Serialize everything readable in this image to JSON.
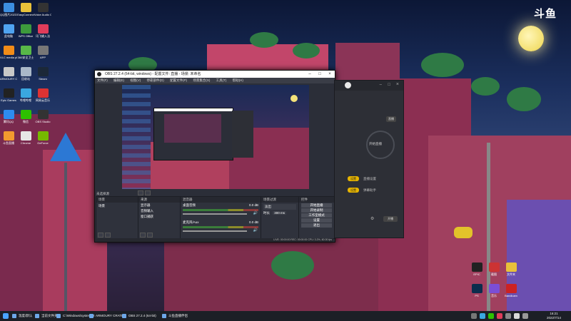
{
  "watermark": "斗鱼",
  "desktop_left": [
    {
      "label": "QQ图片20231231",
      "color": "#3c8ee0"
    },
    {
      "label": "EasyConnect",
      "color": "#e8c13a"
    },
    {
      "label": "Voice Audio Center",
      "color": "#333"
    },
    {
      "label": "此电脑",
      "color": "#4fa3f0"
    },
    {
      "label": "WPS Office",
      "color": "#3d9a3c"
    },
    {
      "label": "讯飞输入法",
      "color": "#e03c5a"
    },
    {
      "label": "VLC media player",
      "color": "#f28c18"
    },
    {
      "label": "360安全卫士",
      "color": "#58b848"
    },
    {
      "label": "APP",
      "color": "#777"
    },
    {
      "label": "ARMOURY CRATE",
      "color": "#c8c8c8"
    },
    {
      "label": "回收站",
      "color": "#aab8c8"
    },
    {
      "label": "Steam",
      "color": "#1b2838"
    },
    {
      "label": "Epic Games",
      "color": "#222"
    },
    {
      "label": "哔哩哔哩",
      "color": "#3aa7e0"
    },
    {
      "label": "网易云音乐",
      "color": "#d33"
    },
    {
      "label": "腾讯QQ",
      "color": "#2d8cf0"
    },
    {
      "label": "微信",
      "color": "#2dc100"
    },
    {
      "label": "OBS Studio",
      "color": "#333"
    },
    {
      "label": "斗鱼直播",
      "color": "#f29a2e"
    },
    {
      "label": "Chrome",
      "color": "#e6e6e6"
    },
    {
      "label": "GeForce",
      "color": "#76b900"
    }
  ],
  "desktop_right": [
    {
      "label": "EPIC",
      "color": "#222"
    },
    {
      "label": "截图",
      "color": "#c33"
    },
    {
      "label": "文件夹",
      "color": "#e8c13a"
    },
    {
      "label": "PS",
      "color": "#0b2d4d"
    },
    {
      "label": "音乐",
      "color": "#7b4ed6"
    },
    {
      "label": "Bandicam",
      "color": "#c22"
    }
  ],
  "obs": {
    "title": "OBS 27.2.4 (64-bit, windows) - 配置文件: 直播 - 场景: 未命名",
    "menu": [
      "文件(F)",
      "编辑(E)",
      "视图(V)",
      "停靠部件(D)",
      "配置文件(P)",
      "场景集合(S)",
      "工具(T)",
      "帮助(H)"
    ],
    "docks": {
      "scenes": {
        "title": "场景",
        "items": [
          "场景"
        ]
      },
      "sources": {
        "title": "来源",
        "items": [
          "显示器",
          "音频输入",
          "窗口捕获"
        ]
      },
      "mixer": {
        "title": "混音器",
        "tracks": [
          {
            "name": "桌面音频",
            "level": "0.0 dB"
          },
          {
            "name": "麦克风/Aux",
            "level": "0.0 dB"
          }
        ]
      },
      "transition": {
        "title": "场景过渡",
        "type": "淡出",
        "duration_label": "时长",
        "duration": "300 ms"
      },
      "controls": {
        "title": "控件",
        "buttons": [
          "开始直播",
          "开始录制",
          "工作室模式",
          "设置",
          "退出"
        ]
      }
    },
    "status": "LIVE: 00:00:00  REC: 00:00:00  CPU: 3.2%, 60.00 fps",
    "scene_bar_label": "未选择源"
  },
  "side_panel": {
    "badge": "直播",
    "start_label": "开始直播",
    "tags": [
      "设置",
      "设置"
    ],
    "rows": [
      "直播设置",
      "弹幕助手"
    ],
    "footer": "开播"
  },
  "taskbar": {
    "items": [
      "温度/默认",
      "当前文件夹",
      "C:\\Windows\\system32",
      "ARMOURY CRATE",
      "OBS 27.2.4 (64-bit)",
      "斗鱼直播伴侣"
    ],
    "time": "16:21",
    "date": "2022/7/14"
  }
}
